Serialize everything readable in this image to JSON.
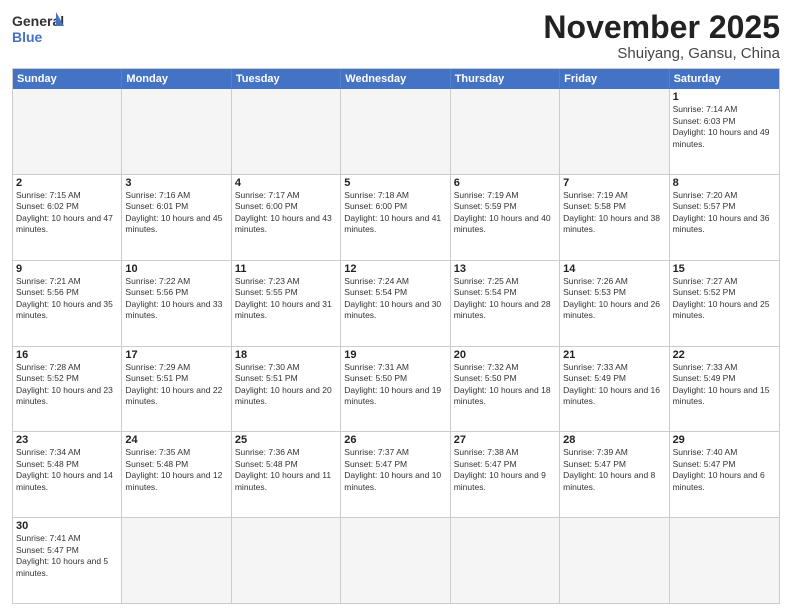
{
  "header": {
    "logo_general": "General",
    "logo_blue": "Blue",
    "month_title": "November 2025",
    "location": "Shuiyang, Gansu, China"
  },
  "day_headers": [
    "Sunday",
    "Monday",
    "Tuesday",
    "Wednesday",
    "Thursday",
    "Friday",
    "Saturday"
  ],
  "weeks": [
    [
      {
        "day": "",
        "info": ""
      },
      {
        "day": "",
        "info": ""
      },
      {
        "day": "",
        "info": ""
      },
      {
        "day": "",
        "info": ""
      },
      {
        "day": "",
        "info": ""
      },
      {
        "day": "",
        "info": ""
      },
      {
        "day": "1",
        "info": "Sunrise: 7:14 AM\nSunset: 6:03 PM\nDaylight: 10 hours and 49 minutes."
      }
    ],
    [
      {
        "day": "2",
        "info": "Sunrise: 7:15 AM\nSunset: 6:02 PM\nDaylight: 10 hours and 47 minutes."
      },
      {
        "day": "3",
        "info": "Sunrise: 7:16 AM\nSunset: 6:01 PM\nDaylight: 10 hours and 45 minutes."
      },
      {
        "day": "4",
        "info": "Sunrise: 7:17 AM\nSunset: 6:00 PM\nDaylight: 10 hours and 43 minutes."
      },
      {
        "day": "5",
        "info": "Sunrise: 7:18 AM\nSunset: 6:00 PM\nDaylight: 10 hours and 41 minutes."
      },
      {
        "day": "6",
        "info": "Sunrise: 7:19 AM\nSunset: 5:59 PM\nDaylight: 10 hours and 40 minutes."
      },
      {
        "day": "7",
        "info": "Sunrise: 7:19 AM\nSunset: 5:58 PM\nDaylight: 10 hours and 38 minutes."
      },
      {
        "day": "8",
        "info": "Sunrise: 7:20 AM\nSunset: 5:57 PM\nDaylight: 10 hours and 36 minutes."
      }
    ],
    [
      {
        "day": "9",
        "info": "Sunrise: 7:21 AM\nSunset: 5:56 PM\nDaylight: 10 hours and 35 minutes."
      },
      {
        "day": "10",
        "info": "Sunrise: 7:22 AM\nSunset: 5:56 PM\nDaylight: 10 hours and 33 minutes."
      },
      {
        "day": "11",
        "info": "Sunrise: 7:23 AM\nSunset: 5:55 PM\nDaylight: 10 hours and 31 minutes."
      },
      {
        "day": "12",
        "info": "Sunrise: 7:24 AM\nSunset: 5:54 PM\nDaylight: 10 hours and 30 minutes."
      },
      {
        "day": "13",
        "info": "Sunrise: 7:25 AM\nSunset: 5:54 PM\nDaylight: 10 hours and 28 minutes."
      },
      {
        "day": "14",
        "info": "Sunrise: 7:26 AM\nSunset: 5:53 PM\nDaylight: 10 hours and 26 minutes."
      },
      {
        "day": "15",
        "info": "Sunrise: 7:27 AM\nSunset: 5:52 PM\nDaylight: 10 hours and 25 minutes."
      }
    ],
    [
      {
        "day": "16",
        "info": "Sunrise: 7:28 AM\nSunset: 5:52 PM\nDaylight: 10 hours and 23 minutes."
      },
      {
        "day": "17",
        "info": "Sunrise: 7:29 AM\nSunset: 5:51 PM\nDaylight: 10 hours and 22 minutes."
      },
      {
        "day": "18",
        "info": "Sunrise: 7:30 AM\nSunset: 5:51 PM\nDaylight: 10 hours and 20 minutes."
      },
      {
        "day": "19",
        "info": "Sunrise: 7:31 AM\nSunset: 5:50 PM\nDaylight: 10 hours and 19 minutes."
      },
      {
        "day": "20",
        "info": "Sunrise: 7:32 AM\nSunset: 5:50 PM\nDaylight: 10 hours and 18 minutes."
      },
      {
        "day": "21",
        "info": "Sunrise: 7:33 AM\nSunset: 5:49 PM\nDaylight: 10 hours and 16 minutes."
      },
      {
        "day": "22",
        "info": "Sunrise: 7:33 AM\nSunset: 5:49 PM\nDaylight: 10 hours and 15 minutes."
      }
    ],
    [
      {
        "day": "23",
        "info": "Sunrise: 7:34 AM\nSunset: 5:48 PM\nDaylight: 10 hours and 14 minutes."
      },
      {
        "day": "24",
        "info": "Sunrise: 7:35 AM\nSunset: 5:48 PM\nDaylight: 10 hours and 12 minutes."
      },
      {
        "day": "25",
        "info": "Sunrise: 7:36 AM\nSunset: 5:48 PM\nDaylight: 10 hours and 11 minutes."
      },
      {
        "day": "26",
        "info": "Sunrise: 7:37 AM\nSunset: 5:47 PM\nDaylight: 10 hours and 10 minutes."
      },
      {
        "day": "27",
        "info": "Sunrise: 7:38 AM\nSunset: 5:47 PM\nDaylight: 10 hours and 9 minutes."
      },
      {
        "day": "28",
        "info": "Sunrise: 7:39 AM\nSunset: 5:47 PM\nDaylight: 10 hours and 8 minutes."
      },
      {
        "day": "29",
        "info": "Sunrise: 7:40 AM\nSunset: 5:47 PM\nDaylight: 10 hours and 6 minutes."
      }
    ],
    [
      {
        "day": "30",
        "info": "Sunrise: 7:41 AM\nSunset: 5:47 PM\nDaylight: 10 hours and 5 minutes."
      },
      {
        "day": "",
        "info": ""
      },
      {
        "day": "",
        "info": ""
      },
      {
        "day": "",
        "info": ""
      },
      {
        "day": "",
        "info": ""
      },
      {
        "day": "",
        "info": ""
      },
      {
        "day": "",
        "info": ""
      }
    ]
  ]
}
